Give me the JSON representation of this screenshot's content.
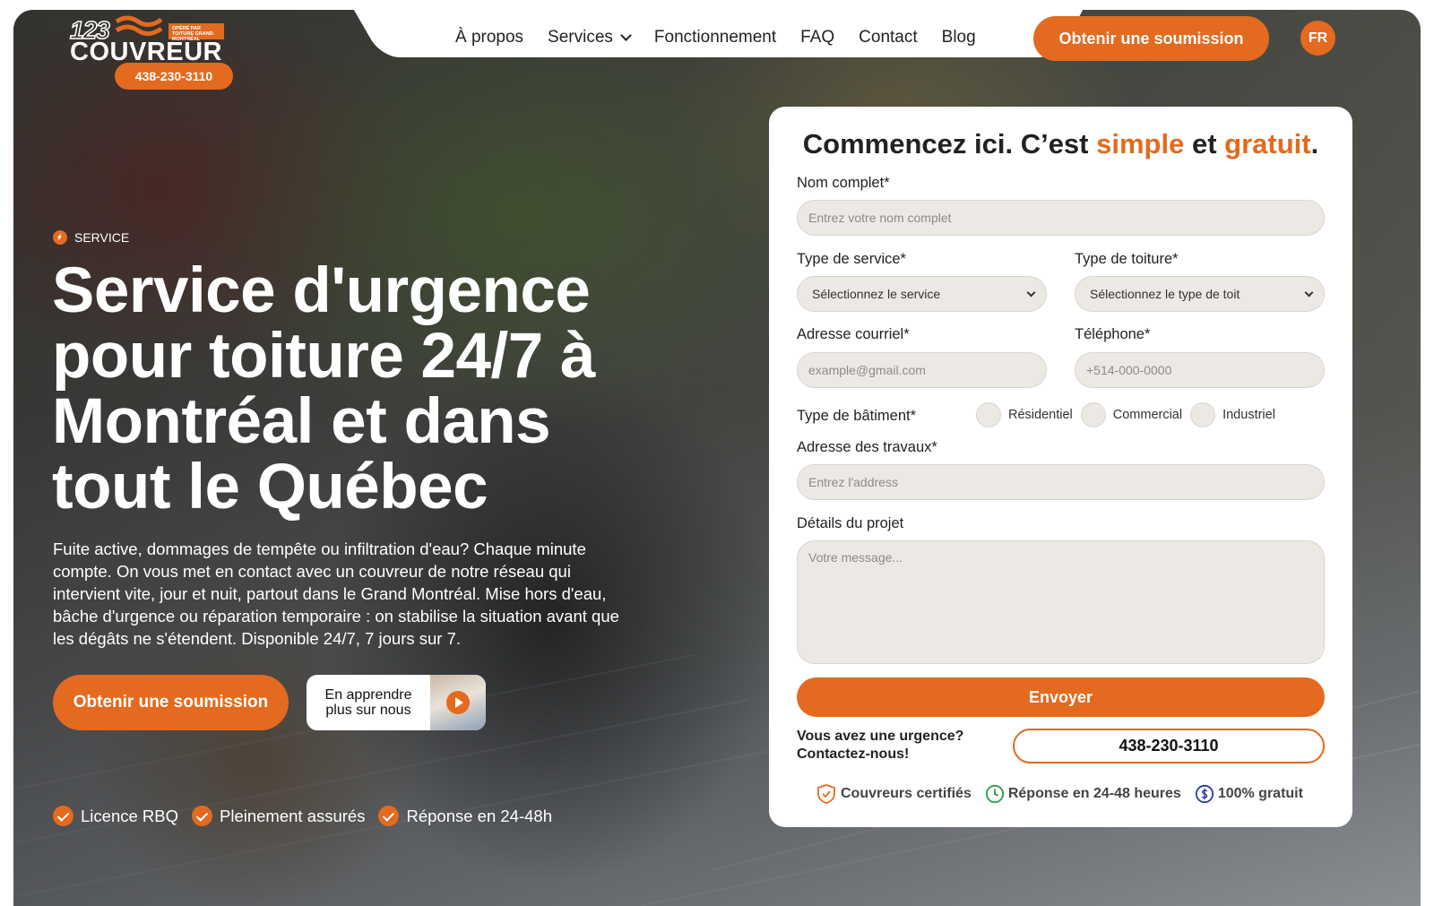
{
  "logo": {
    "number": "123",
    "word": "COUVREUR",
    "tagline": "OPÉRÉ PAR TOITURE GRAND-MONTRÉAL",
    "phone": "438-230-3110"
  },
  "nav": {
    "links": [
      "À propos",
      "Services",
      "Fonctionnement",
      "FAQ",
      "Contact",
      "Blog"
    ],
    "cta": "Obtenir une soumission",
    "language": "FR"
  },
  "hero": {
    "eyebrow": "SERVICE",
    "headline": "Service d'urgence pour toiture 24/7 à Montréal et dans tout le Québec",
    "lede": "Fuite active, dommages de tempête ou infiltration d'eau? Chaque minute compte. On vous met en contact avec un couvreur de notre réseau qui intervient vite, jour et nuit, partout dans le Grand Montréal. Mise hors d'eau, bâche d'urgence ou réparation temporaire : on stabilise la situation avant que les dégâts ne s'étendent. Disponible 24/7, 7 jours sur 7.",
    "cta": "Obtenir une soumission",
    "learn_more_line1": "En apprendre",
    "learn_more_line2": "plus sur nous",
    "badges": [
      "Licence RBQ",
      "Pleinement assurés",
      "Réponse en 24-48h"
    ]
  },
  "form": {
    "title_start": "Commencez ici. C’est ",
    "title_simple": "simple",
    "title_mid": " et ",
    "title_free": "gratuit",
    "title_end": ".",
    "name_label": "Nom complet*",
    "name_placeholder": "Entrez votre nom complet",
    "service_label": "Type de service*",
    "service_value": "Sélectionnez le service",
    "roof_label": "Type de toiture*",
    "roof_value": "Sélectionnez le type de toit",
    "email_label": "Adresse courriel*",
    "email_placeholder": "example@gmail.com",
    "phone_label": "Téléphone*",
    "phone_placeholder": "+514-000-0000",
    "building_label": "Type de bâtiment*",
    "building_options": [
      "Résidentiel",
      "Commercial",
      "Industriel"
    ],
    "address_label": "Adresse des travaux*",
    "address_placeholder": "Entrez l'address",
    "details_label": "Détails du projet",
    "details_placeholder": "Votre message...",
    "submit": "Envoyer",
    "urgency_line1": "Vous avez une urgence?",
    "urgency_line2": "Contactez-nous!",
    "urgency_phone": "438-230-3110",
    "trust": [
      "Couvreurs certifiés",
      "Réponse en 24-48 heures",
      "100% gratuit"
    ]
  },
  "colors": {
    "accent": "#e36a1f",
    "card": "#ffffff",
    "field": "#ece9e4",
    "clock_icon": "#2a9d4a",
    "dollar_icon": "#2b3a9e"
  },
  "icons": [
    "bolt-icon",
    "chevron-down-icon",
    "check-icon",
    "play-icon",
    "shield-icon",
    "clock-icon",
    "dollar-icon"
  ]
}
